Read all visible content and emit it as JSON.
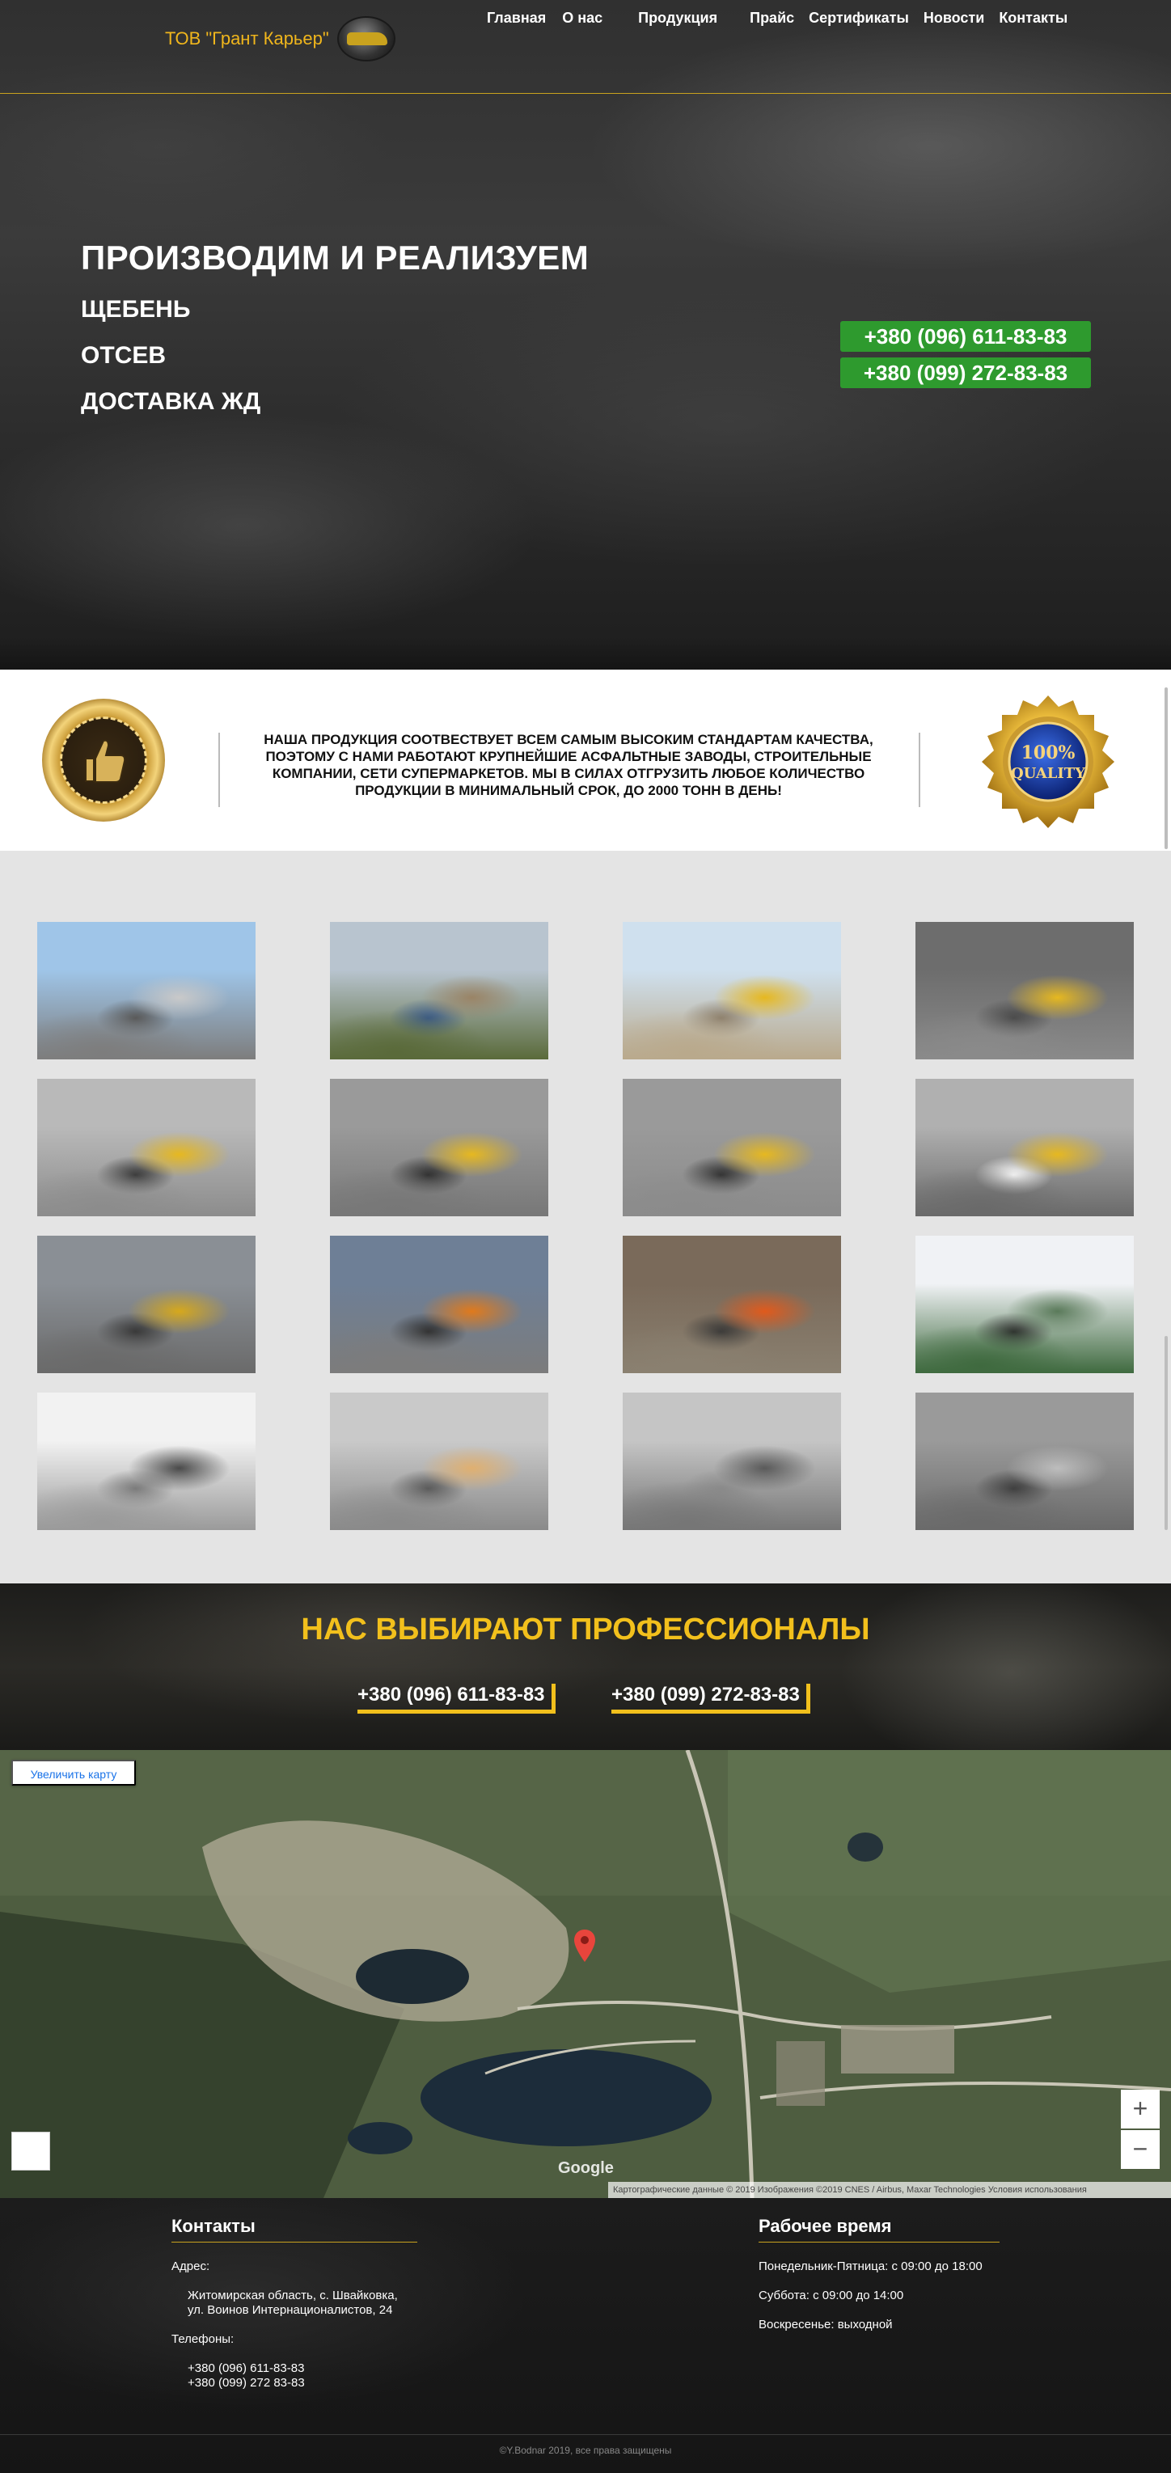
{
  "header": {
    "logo_text": "ТОВ \"Грант Карьер\"",
    "nav": [
      "Главная",
      "О нас",
      "Продукция",
      "Прайс",
      "Сертификаты",
      "Новости",
      "Контакты"
    ]
  },
  "hero": {
    "title": "ПРОИЗВОДИМ И РЕАЛИЗУЕМ",
    "items": [
      "ЩЕБЕНЬ",
      "ОТСЕВ",
      "ДОСТАВКА ЖД"
    ],
    "phones": [
      "+380 (096) 611-83-83",
      "+380 (099) 272-83-83"
    ],
    "phone_color": "#2e9a2e"
  },
  "quality": {
    "text": "НАША ПРОДУКЦИЯ СООТВЕСТВУЕТ ВСЕМ САМЫМ ВЫСОКИМ СТАНДАРТАМ КАЧЕСТВА, ПОЭТОМУ С НАМИ РАБОТАЮТ КРУПНЕЙШИЕ АСФАЛЬТНЫЕ ЗАВОДЫ, СТРОИТЕЛЬНЫЕ КОМПАНИИ, СЕТИ СУПЕРМАРКЕТОВ. МЫ В СИЛАХ ОТГРУЗИТЬ ЛЮБОЕ КОЛИЧЕСТВО ПРОДУКЦИИ В МИНИМАЛЬНЫЙ СРОК, ДО 2000 ТОНН В ДЕНЬ!",
    "badge_left_text": "QUALITY · BEST QUALITY · BEST",
    "badge_right_line1": "100%",
    "badge_right_line2": "QUALITY"
  },
  "gallery": {
    "photos": [
      "crushing-plant",
      "mobile-crusher",
      "yellow-crusher",
      "quarry-loader",
      "wheel-loader-dumping",
      "wheel-loader-front",
      "loader-bucket",
      "dump-truck-loading",
      "mining-truck-loading",
      "loader-and-train",
      "wagon-unloading",
      "rail-wagon",
      "crushed-stone-pile",
      "gravel-sand-piles",
      "gravel-mound",
      "crushed-stone-closeup"
    ]
  },
  "pros": {
    "title": "НАС ВЫБИРАЮТ ПРОФЕССИОНАЛЫ",
    "phones": [
      "+380 (096) 611-83-83",
      "+380 (099) 272-83-83"
    ],
    "accent": "#f2c01c"
  },
  "map": {
    "enlarge_button": "Увеличить карту",
    "zoom_in": "+",
    "zoom_out": "−",
    "google": "Google",
    "credits": "Картографические данные © 2019 Изображения ©2019 CNES / Airbus, Maxar Technologies     Условия использования"
  },
  "footer": {
    "contacts_title": "Контакты",
    "address_label": "Адрес:",
    "address_line1": "Житомирская область, с. Швайковка,",
    "address_line2": "ул. Воинов Интернационалистов, 24",
    "phones_label": "Телефоны:",
    "phone1": "+380 (096) 611-83-83",
    "phone2": "+380 (099) 272 83-83",
    "hours_title": "Рабочее время",
    "hours_weekdays": "Понедельник-Пятница: с 09:00 до 18:00",
    "hours_saturday": "Суббота: с 09:00 до 14:00",
    "hours_sunday": "Воскресенье: выходной",
    "copyright": "©Y.Bodnar 2019, все права защищены"
  }
}
